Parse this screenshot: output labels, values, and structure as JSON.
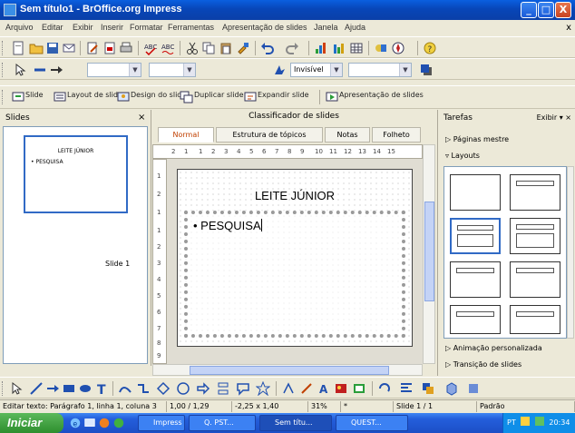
{
  "window": {
    "title": "Sem título1 - BrOffice.org Impress",
    "minimize_label": "_",
    "maximize_label": "□",
    "close_label": "X"
  },
  "menu": {
    "items": [
      "Arquivo",
      "Editar",
      "Exibir",
      "Inserir",
      "Formatar",
      "Ferramentas",
      "Apresentação de slides",
      "Janela",
      "Ajuda"
    ],
    "close_label": "x"
  },
  "line_toolbar": {
    "line_color_value": "Invisível"
  },
  "draw_toolbar": {
    "items": [
      "Slide",
      "Layout de slide",
      "Design do slide",
      "Duplicar slide",
      "Expandir slide",
      "Apresentação de slides"
    ]
  },
  "slides_panel": {
    "title": "Slides",
    "close_label": "×",
    "thumbnail_title": "LEITE JÚNIOR",
    "thumbnail_bullet": "• PESQUISA",
    "slide_label": "Slide 1"
  },
  "editor": {
    "caption": "Classificador de slides",
    "tabs": [
      "Normal",
      "Estrutura de tópicos",
      "Notas",
      "Folheto"
    ],
    "active_tab": "Normal",
    "hruler_numbers": [
      "2",
      "1",
      "1",
      "2",
      "3",
      "4",
      "5",
      "6",
      "7",
      "8",
      "9",
      "10",
      "11",
      "12",
      "13",
      "14",
      "15"
    ],
    "vruler_numbers": [
      "1",
      "2",
      "1",
      "1",
      "2",
      "3",
      "4",
      "5",
      "6",
      "7",
      "8",
      "9"
    ],
    "slide": {
      "title": "LEITE JÚNIOR",
      "bullet": "• PESQUISA"
    }
  },
  "tasks_panel": {
    "title": "Tarefas",
    "view_label": "Exibir ▾ ×",
    "sections": {
      "master_pages": "▷ Páginas mestre",
      "layouts": "▿ Layouts",
      "custom_animation": "▷ Animação personalizada",
      "slide_transition": "▷ Transição de slides"
    }
  },
  "statusbar": {
    "fields": [
      "Editar texto: Parágrafo 1, linha 1, coluna 3",
      "1,00 / 1,29",
      "-2,25 x 1,40",
      "31%",
      "*",
      "Slide 1 / 1",
      "Padrão"
    ]
  },
  "taskbar": {
    "start_label": "Iniciar",
    "tasks": [
      "Impress",
      "Q. PST...",
      "Sem títu...",
      "QUEST..."
    ],
    "active_task": "Sem títu...",
    "tray_lang": "PT",
    "clock": "20:34"
  },
  "colors": {
    "titlebar": "#0846b8",
    "accent": "#316ac5",
    "start_button": "#2e8e2e",
    "taskbar": "#245edb",
    "active_tab_text": "#c04000"
  }
}
